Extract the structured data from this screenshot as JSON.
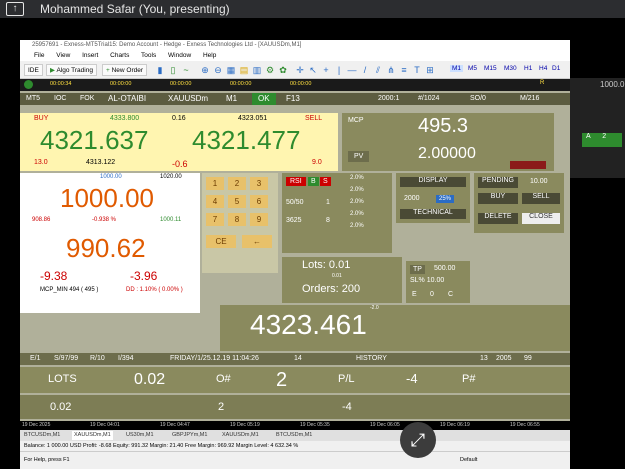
{
  "meet": {
    "presenter": "Mohammed Safar (You, presenting)"
  },
  "window": {
    "title": "25957691 - Exness-MT5Trial15: Demo Account - Hedge - Exness Technologies Ltd - [XAUUSDm,M1]"
  },
  "menu": [
    "File",
    "View",
    "Insert",
    "Charts",
    "Tools",
    "Window",
    "Help"
  ],
  "toolbar": {
    "ide": "IDE",
    "algo": "Algo Trading",
    "new_order": "New Order",
    "timeframes": [
      "M1",
      "M5",
      "M15",
      "M30",
      "H1",
      "H4",
      "D1",
      "W1"
    ]
  },
  "timeline": [
    "00:00:34",
    "00:00:00",
    "00:00:00",
    "00:00:00",
    "00:00:00"
  ],
  "panel": {
    "buy_label": "BUY",
    "sell_label": "SELL",
    "buy_top": "4333.800",
    "spread_top": "0.16",
    "sell_top": "4323.051",
    "bid": "4321.637",
    "ask": "4321.477",
    "buy_small": "13.0",
    "buy_mid": "4313.122",
    "diff": "-0.6",
    "sell_small": "9.0",
    "mcp_label": "MCP",
    "mcp_value": "495.3",
    "pv_label": "PV",
    "pv_value": "2.00000",
    "range_low": "1000.00",
    "range_high": "1020.00",
    "main_value": "1000.00",
    "small_left": "908.86",
    "small_pct": "-0.938 %",
    "small_right": "1000.11",
    "equity": "990.62",
    "loss_left": "-9.38",
    "loss_right": "-3.96",
    "mcp_min": "MCP_MIN 494 ( 495 )",
    "dd": "DD : 1.10% ( 0.00% )",
    "keypad": [
      "1",
      "2",
      "3",
      "4",
      "5",
      "6",
      "7",
      "8",
      "9"
    ],
    "ce": "CE",
    "back": "←",
    "rsi": "RSI",
    "b": "B",
    "s": "S",
    "ratio": "50/50",
    "one": "1",
    "num_3625": "3625",
    "num_8": "8",
    "pct_col": [
      "2.0%",
      "2.0%",
      "2.0%",
      "2.0%",
      "2.0%"
    ],
    "display": "DISPLAY",
    "n2000": "2000",
    "pct25": "25%",
    "technical": "TECHNICAL",
    "pending": "PENDING",
    "pending_val": "10.00",
    "buy_btn": "BUY",
    "sell_btn": "SELL",
    "delete": "DELETE",
    "close": "CLOSE",
    "lots_label": "Lots: 0.01",
    "lots_small": "0.01",
    "orders_label": "Orders: 200",
    "tp_label": "TP",
    "tp_val": "500.00",
    "sl_label": "SL% 10.00",
    "e": "E",
    "zero": "0",
    "c": "C",
    "price_big": "4323.461",
    "neg_small": "-2.0",
    "header_items": [
      "MT5",
      "IOC",
      "FOK",
      "AL-OTAIBI",
      "XAUUSDm",
      "M1",
      "OK",
      "F13",
      "2000:1",
      "#/1024",
      "SO/0",
      "M/216"
    ],
    "info_bar": [
      "E/1",
      "S/97/99",
      "R/10",
      "I/394",
      "FRIDAY/1/25.12.19 11:04:26",
      "14",
      "HISTORY",
      "13",
      "2005",
      "99"
    ],
    "lots_row": {
      "label": "LOTS",
      "value": "0.02",
      "o_label": "O#",
      "o_value": "2",
      "pl_label": "P/L",
      "pl_value": "-4",
      "p_label": "P#"
    },
    "lots_row2": {
      "value": "0.02",
      "o_value": "2",
      "pl_value": "-4"
    }
  },
  "side": {
    "top": "1000.0",
    "v1": "A",
    "v2": "2"
  },
  "time_axis": [
    "19 Dec 2025",
    "19 Dec 04:01",
    "19 Dec 04:47",
    "19 Dec 05:19",
    "19 Dec 05:35",
    "19 Dec 06:05",
    "19 Dec 06:19",
    "19 Dec 06:55"
  ],
  "tabs": [
    "BTCUSDm,M1",
    "XAUUSDm,M1",
    "US30m,M1",
    "GBPJPYm,M1",
    "XAUUSDm,M1",
    "BTCUSDm,M1"
  ],
  "status": "Balance: 1 000.00 USD  Profit: -8.68  Equity: 991.32  Margin: 21.40  Free Margin: 969.92  Margin Level: 4 632.34 %",
  "help": "For Help, press F1",
  "default": "Default"
}
